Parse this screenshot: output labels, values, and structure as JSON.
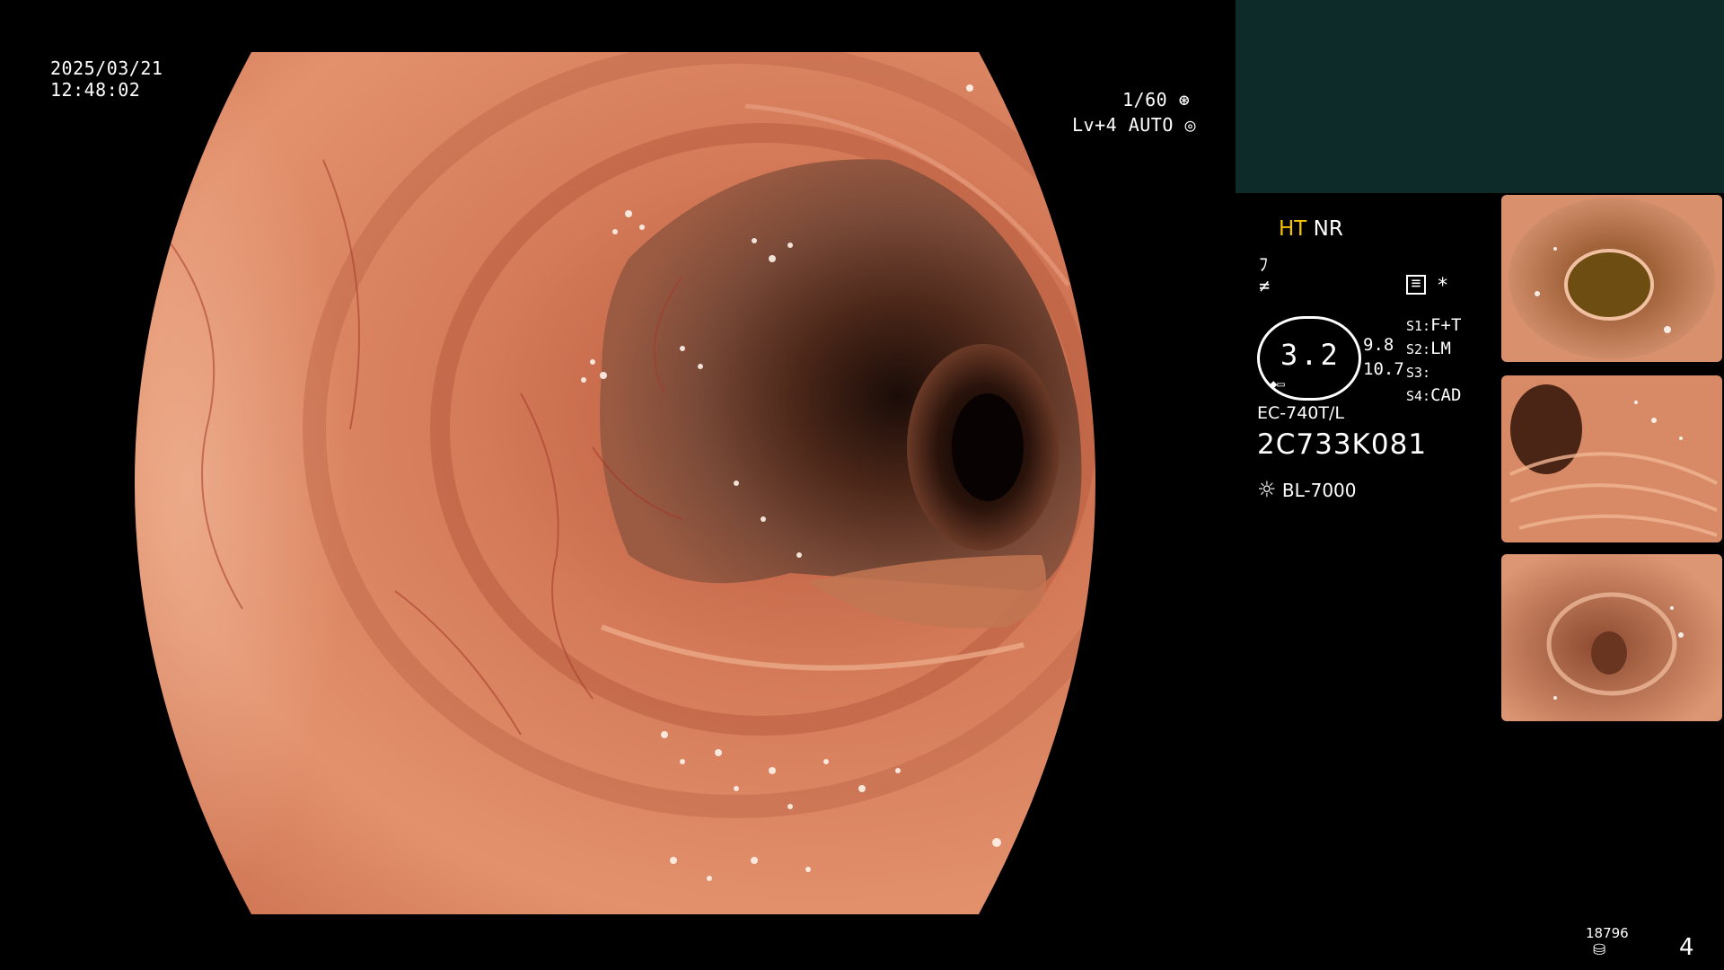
{
  "overlay": {
    "date": "2025/03/21",
    "time": "12:48:02",
    "shutter": "1/60",
    "shutter_icon": "shutter-icon",
    "level": "Lv+4",
    "exposure_mode": "AUTO",
    "exposure_icon": "auto-iris-icon"
  },
  "panel": {
    "mode_ht": "HT",
    "mode_nr": "NR",
    "color_ht": "#f5c400",
    "zoom_value": "3.2",
    "zoom_side_1": "9.8",
    "zoom_side_2": "10.7",
    "switches": [
      {
        "key": "S1:",
        "value": "F+T"
      },
      {
        "key": "S2:",
        "value": "LM"
      },
      {
        "key": "S3:",
        "value": ""
      },
      {
        "key": "S4:",
        "value": "CAD"
      }
    ],
    "asterisk": "*",
    "scope_model": "EC-740T/L",
    "scope_serial": "2C733K081",
    "light_source": "BL-7000",
    "light_icon": "sun-icon",
    "record_count": "18796",
    "record_icon": "database-icon",
    "page_number": "4"
  },
  "thumbnails": [
    {
      "name": "captured-image-1"
    },
    {
      "name": "captured-image-2"
    },
    {
      "name": "captured-image-3"
    }
  ]
}
